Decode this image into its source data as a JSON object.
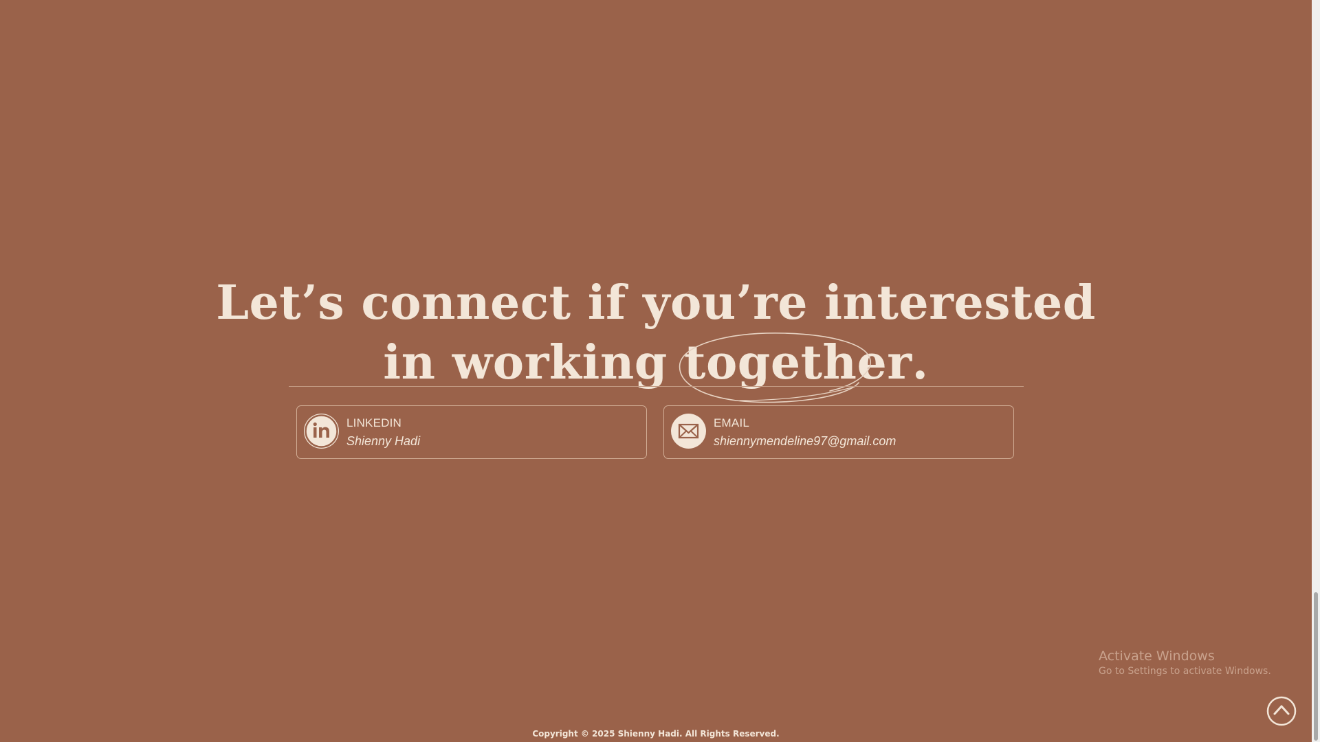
{
  "colors": {
    "background": "#9a624a",
    "text": "#f3e6d8",
    "divider": "#c29a83",
    "card_border": "#d1ad95",
    "watermark": "#c9a28d"
  },
  "contact": {
    "headline_line1": "Let’s connect if you’re interested",
    "headline_line2_prefix": "in working ",
    "headline_highlight": "together",
    "headline_period": ".",
    "cards": [
      {
        "icon": "linkedin-icon",
        "label": "LINKEDIN",
        "value": "Shienny Hadi"
      },
      {
        "icon": "mail-icon",
        "label": "EMAIL",
        "value": "shiennymendeline97@gmail.com"
      }
    ]
  },
  "watermark": {
    "title": "Activate Windows",
    "subtitle": "Go to Settings to activate Windows."
  },
  "back_to_top": {
    "icon": "chevron-up-circle-icon"
  },
  "footer": {
    "copyright": "Copyright © 2025 Shienny Hadi. All Rights Reserved."
  }
}
